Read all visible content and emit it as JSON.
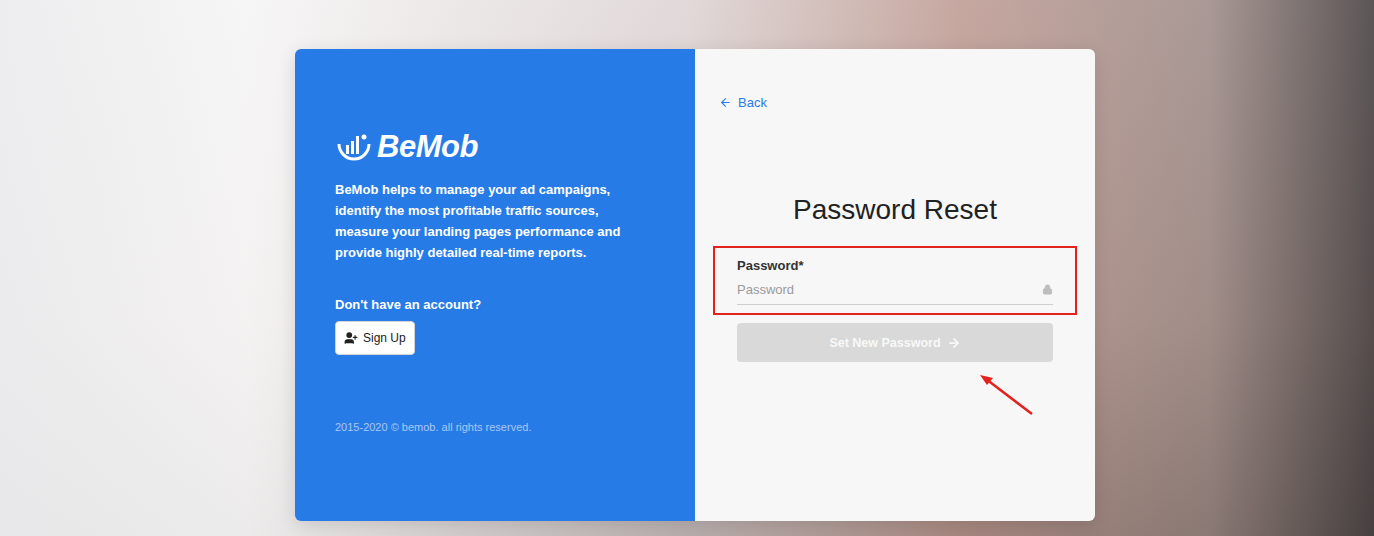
{
  "brand": {
    "name": "BeMob",
    "tagline": "BeMob helps to manage your ad campaigns, identify the most profitable traffic sources, measure your landing pages performance and provide highly detailed real-time reports.",
    "signup_prompt": "Don't have an account?",
    "signup_button": "Sign Up",
    "copyright": "2015-2020 © bemob. all rights reserved."
  },
  "back_link": "Back",
  "title": "Password Reset",
  "field": {
    "label": "Password*",
    "placeholder": "Password",
    "highlighted": true
  },
  "submit": {
    "label": "Set New Password",
    "disabled": true,
    "pointed_at": true
  }
}
